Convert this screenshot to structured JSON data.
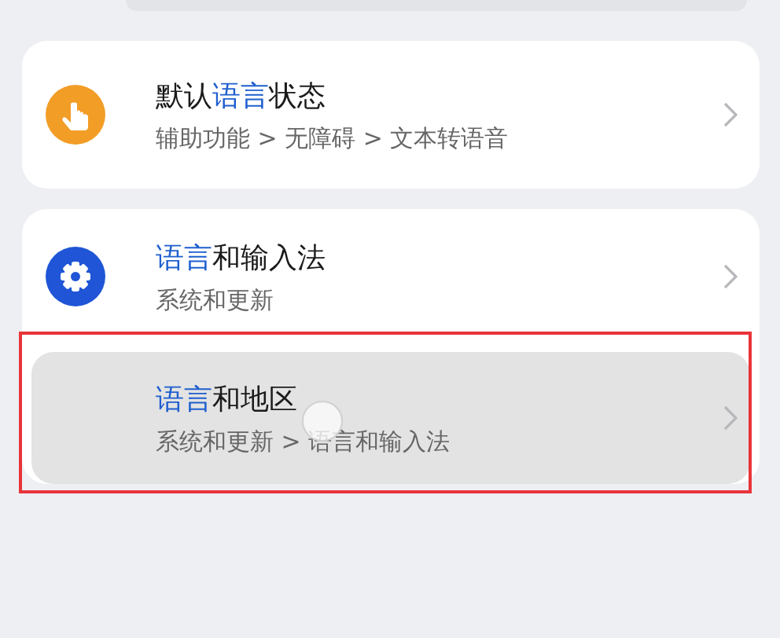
{
  "cards": [
    {
      "rows": [
        {
          "kind": "hand",
          "title_parts": [
            {
              "text": "默认",
              "highlighted": false
            },
            {
              "text": "语言",
              "highlighted": true
            },
            {
              "text": "状态",
              "highlighted": false
            }
          ],
          "path": "辅助功能 > 无障碍 > 文本转语音",
          "pressed": false,
          "outlined": false
        }
      ]
    },
    {
      "rows": [
        {
          "kind": "gear",
          "title_parts": [
            {
              "text": "语言",
              "highlighted": true
            },
            {
              "text": "和输入法",
              "highlighted": false
            }
          ],
          "path": "系统和更新",
          "pressed": false,
          "outlined": false
        },
        {
          "kind": "plain",
          "title_parts": [
            {
              "text": "语言",
              "highlighted": true
            },
            {
              "text": "和地区",
              "highlighted": false
            }
          ],
          "path": "系统和更新 > 语言和输入法",
          "pressed": true,
          "outlined": true
        }
      ]
    }
  ]
}
